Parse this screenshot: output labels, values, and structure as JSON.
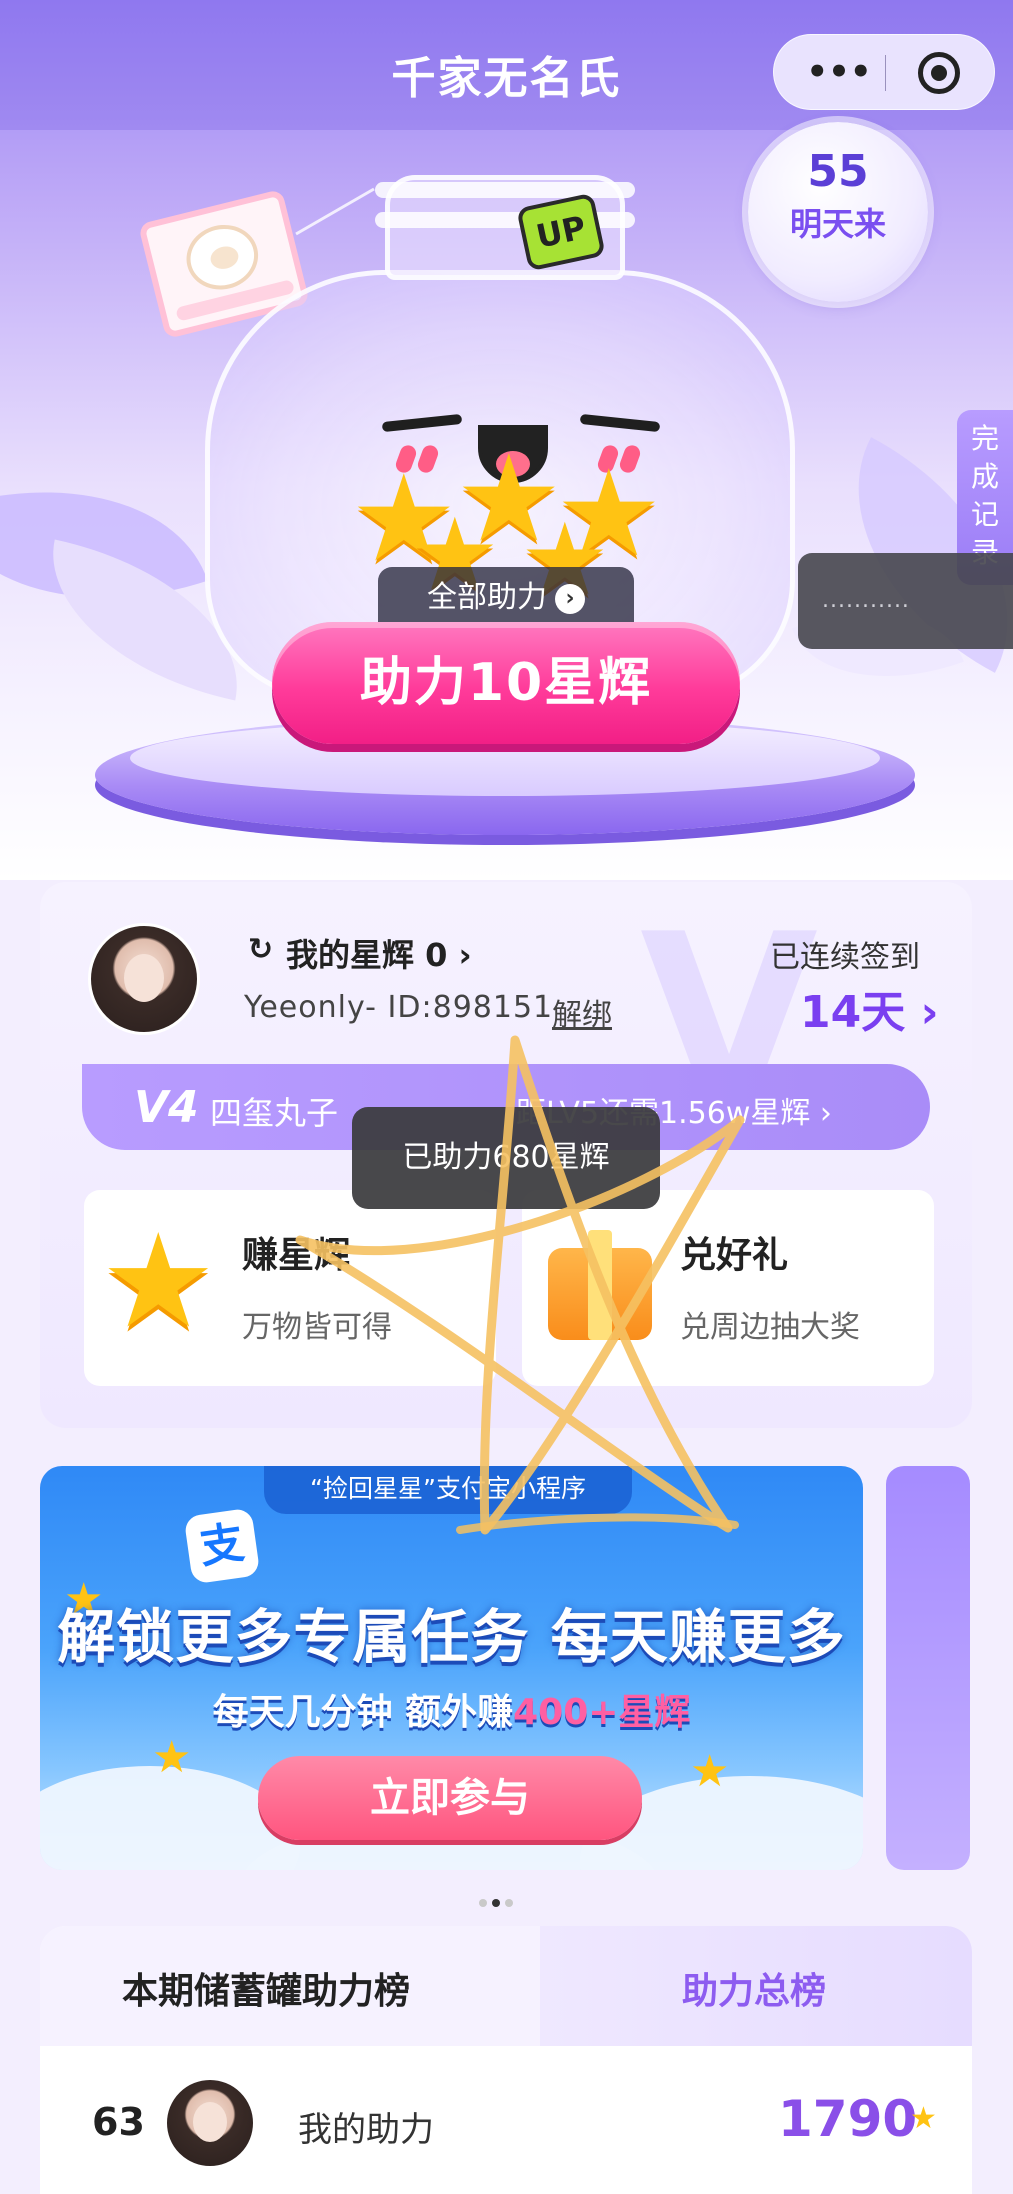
{
  "header": {
    "title": "千家无名氏",
    "more_glyph": "•••",
    "more_icon": "more-icon",
    "target_icon": "target-icon"
  },
  "hero": {
    "countdown_number": "55",
    "countdown_text": "明天来",
    "up_badge": "UP",
    "all_help_label": "全部助力",
    "all_help_arrow": "›",
    "help_button": "助力10星辉",
    "side_tab": [
      "完",
      "成",
      "记",
      "录"
    ],
    "right_toast_text": "..........."
  },
  "user": {
    "stars_label": "我的星辉 0 ›",
    "refresh_glyph": "↻",
    "id_text": "Yeeonly- ID:898151",
    "unbind_label": "解绑",
    "streak_label": "已连续签到",
    "streak_days": "14天 ›",
    "level_badge": "V4",
    "level_name": "四玺丸子",
    "level_next": "距LV5还需1.56w星辉 ›",
    "earn_title": "赚星辉",
    "earn_sub": "万物皆可得",
    "redeem_title": "兑好礼",
    "redeem_sub": "兑周边抽大奖"
  },
  "toast": {
    "message": "已助力680星辉"
  },
  "banner": {
    "mini_tag": "“捡回星星”支付宝小程序",
    "alipay_glyph": "支",
    "headline": "解锁更多专属任务 每天赚更多",
    "sub_prefix": "每天几分钟 额外赚",
    "sub_highlight": "400+星辉",
    "join_button": "立即参与",
    "page_index": 2,
    "page_count": 3
  },
  "ranking": {
    "title": "本期储蓄罐助力榜",
    "total_tab": "助力总榜",
    "my_rank": "63",
    "my_label": "我的助力",
    "my_score": "1790",
    "star_glyph": "★"
  },
  "colors": {
    "accent_purple": "#8d5cf0",
    "help_pink": "#ff3b9a",
    "star_yellow": "#ffc313",
    "banner_blue": "#2f89f6",
    "scribble": "#f5c162"
  }
}
